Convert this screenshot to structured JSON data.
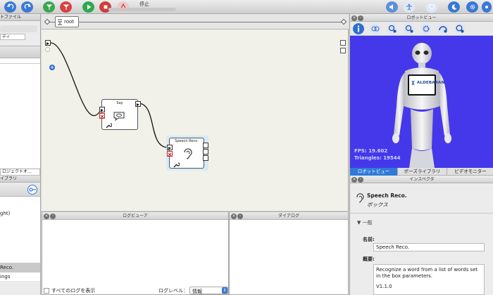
{
  "toolbar": {
    "status": "停止"
  },
  "left_panel": {
    "project_files": "トファイル",
    "properties": "ティ",
    "project_objects": "ロジェクトオ...",
    "libraries": "イブラリ",
    "list_item_1": "ght)",
    "list_item_selected": "Reco.",
    "list_item_3": "ings"
  },
  "diagram": {
    "breadcrumb": "root",
    "boxes": [
      {
        "title": "Say"
      },
      {
        "title": "Speech Reco."
      }
    ]
  },
  "log_viewer": {
    "title": "ログビューア",
    "show_all_label": "すべてのログを表示",
    "level_label": "ログレベル：",
    "level_value": "情報"
  },
  "dialog": {
    "title": "ダイアログ"
  },
  "robot_view": {
    "title": "ロボットビュー",
    "fps": "FPS: 19.602",
    "triangles": "Triangles: 19544",
    "brand": "ALDEBARAN",
    "tabs": [
      "ロボットビュー",
      "ポーズライブラリ",
      "ビデオモニター"
    ]
  },
  "inspector": {
    "title": "インスペクタ",
    "box_name": "Speech Reco.",
    "box_type": "ボックス",
    "section": "一般",
    "name_label": "名前:",
    "name_value": "Speech Reco.",
    "summary_label": "概要:",
    "summary_text": "Recognize a word from a list of words set in the box parameters.",
    "version": "V1.1.0"
  },
  "colors": {
    "robot_bg": "#4538ea",
    "selection": "#2f7ad8",
    "play_green": "#2fa84f",
    "stop_red": "#d23b3b"
  }
}
